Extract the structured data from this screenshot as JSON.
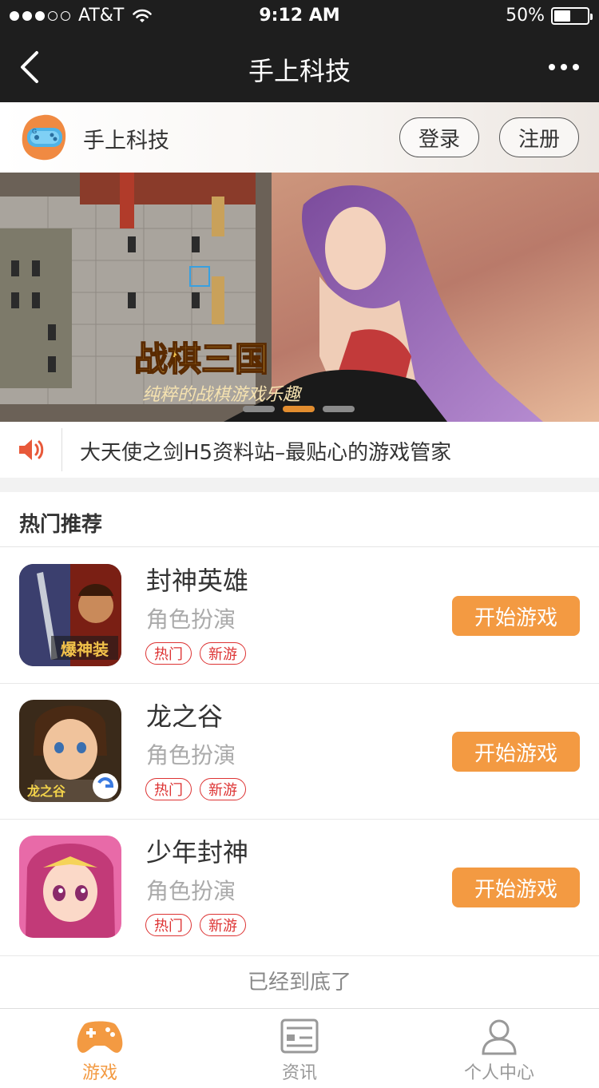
{
  "status_bar": {
    "carrier": "AT&T",
    "time": "9:12 AM",
    "battery": "50%",
    "battery_level": 0.5,
    "signal_bars_filled": 3,
    "signal_bars_total": 5
  },
  "nav": {
    "title": "手上科技",
    "back_icon": "chevron-left-icon",
    "more_icon": "more-dots-icon"
  },
  "header": {
    "site_name": "手上科技",
    "login_label": "登录",
    "register_label": "注册"
  },
  "banner": {
    "headline": "战棋三国",
    "tagline": "纯粹的战棋游戏乐趣",
    "slides": 3,
    "active_slide": 2
  },
  "notice": {
    "icon": "speaker-icon",
    "text": "大天使之剑H5资料站–最贴心的游戏管家"
  },
  "hot": {
    "title": "热门推荐",
    "games": [
      {
        "name": "封神英雄",
        "genre": "角色扮演",
        "tags": [
          "热门",
          "新游"
        ],
        "button": "开始游戏",
        "icon_text": "爆神装"
      },
      {
        "name": "龙之谷",
        "genre": "角色扮演",
        "tags": [
          "热门",
          "新游"
        ],
        "button": "开始游戏",
        "icon_text": "龙之谷"
      },
      {
        "name": "少年封神",
        "genre": "角色扮演",
        "tags": [
          "热门",
          "新游"
        ],
        "button": "开始游戏"
      }
    ],
    "end_text": "已经到底了"
  },
  "tabs": [
    {
      "label": "游戏",
      "icon": "gamepad-icon",
      "active": true
    },
    {
      "label": "资讯",
      "icon": "news-icon",
      "active": false
    },
    {
      "label": "个人中心",
      "icon": "user-icon",
      "active": false
    }
  ],
  "colors": {
    "accent": "#f39a42",
    "tag_red": "#d33333",
    "nav_bg": "#1e1e1e"
  }
}
